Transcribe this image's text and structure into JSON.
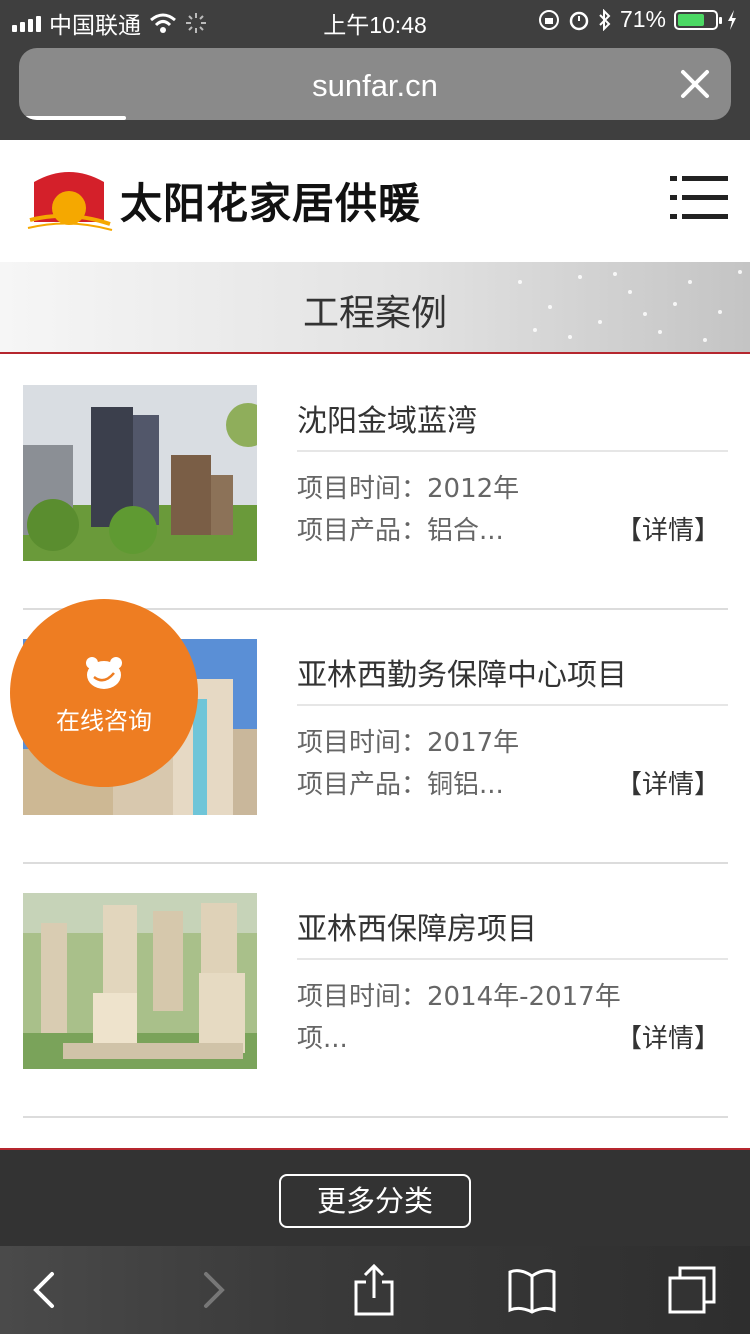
{
  "status": {
    "carrier": "中国联通",
    "time": "上午10:48",
    "battery_pct": "71%",
    "battery_level": 0.71
  },
  "browser": {
    "url": "sunfar.cn",
    "load_progress": 0.15
  },
  "header": {
    "logo_text": "太阳花家居供暖"
  },
  "banner": {
    "title": "工程案例"
  },
  "projects": [
    {
      "name": "沈阳金域蓝湾",
      "time": "项目时间：2012年",
      "product": "项目产品：铝合...",
      "detail": "【详情】"
    },
    {
      "name": "亚林西勤务保障中心项目",
      "time": "项目时间：2017年",
      "product": "项目产品：铜铝...",
      "detail": "【详情】"
    },
    {
      "name": "亚林西保障房项目",
      "time": "项目时间：2014年-2017年",
      "product": "项...",
      "detail": "【详情】"
    }
  ],
  "consult": {
    "label": "在线咨询"
  },
  "more": {
    "label": "更多分类"
  },
  "colors": {
    "accent_red": "#b5262e",
    "consult_orange": "#ee7d22",
    "chrome_dark": "#3f3f3f"
  }
}
